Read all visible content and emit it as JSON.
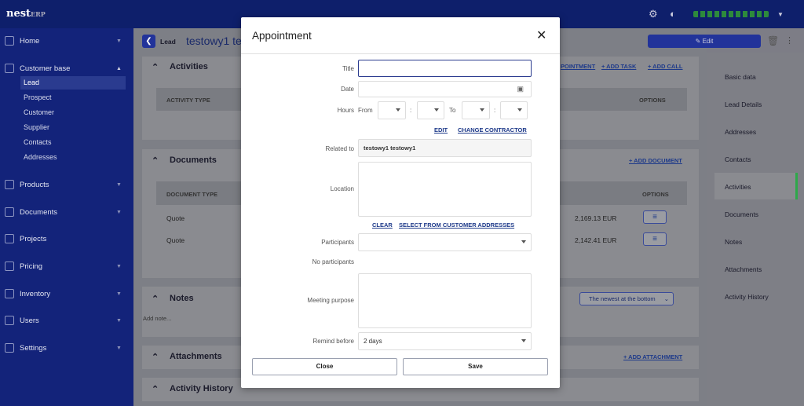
{
  "topbar": {
    "logo_main": "nest",
    "logo_sub": "ERP"
  },
  "sidebar": {
    "items": [
      {
        "label": "Home"
      },
      {
        "label": "Customer base"
      },
      {
        "label": "Products"
      },
      {
        "label": "Documents"
      },
      {
        "label": "Projects"
      },
      {
        "label": "Pricing"
      },
      {
        "label": "Inventory"
      },
      {
        "label": "Users"
      },
      {
        "label": "Settings"
      }
    ],
    "sub": [
      "Lead",
      "Prospect",
      "Customer",
      "Supplier",
      "Contacts",
      "Addresses"
    ]
  },
  "header": {
    "badge": "Lead",
    "title": "testowy1 te",
    "edit": "Edit"
  },
  "activities": {
    "title": "Activities",
    "links": [
      "POINTMENT",
      "+ ADD TASK",
      "+ ADD CALL"
    ],
    "col_type": "ACTIVITY TYPE",
    "col_options": "OPTIONS"
  },
  "documents": {
    "title": "Documents",
    "add": "+ ADD DOCUMENT",
    "col_type": "DOCUMENT TYPE",
    "col_options": "OPTIONS",
    "rows": [
      {
        "type": "Quote",
        "amount": "2,169.13 EUR"
      },
      {
        "type": "Quote",
        "amount": "2,142.41 EUR"
      }
    ]
  },
  "notes": {
    "title": "Notes",
    "add": "Add note...",
    "sort": "The newest at the bottom"
  },
  "attachments": {
    "title": "Attachments",
    "add": "+ ADD ATTACHMENT"
  },
  "history": {
    "title": "Activity History"
  },
  "right_nav": [
    "Basic data",
    "Lead Details",
    "Addresses",
    "Contacts",
    "Activities",
    "Documents",
    "Notes",
    "Attachments",
    "Activity History"
  ],
  "modal": {
    "title": "Appointment",
    "labels": {
      "title": "Title",
      "date": "Date",
      "hours": "Hours",
      "from": "From",
      "to": "To",
      "colon": ":",
      "related": "Related to",
      "location": "Location",
      "participants": "Participants",
      "no_participants": "No participants",
      "purpose": "Meeting purpose",
      "remind": "Remind before"
    },
    "title_value": "",
    "date_value": "",
    "related_value": "testowy1 testowy1",
    "remind_value": "2 days",
    "links": {
      "edit": "EDIT",
      "change": "CHANGE CONTRACTOR",
      "clear": "CLEAR",
      "select_addr": "SELECT FROM CUSTOMER ADDRESSES"
    },
    "buttons": {
      "close": "Close",
      "save": "Save"
    }
  }
}
